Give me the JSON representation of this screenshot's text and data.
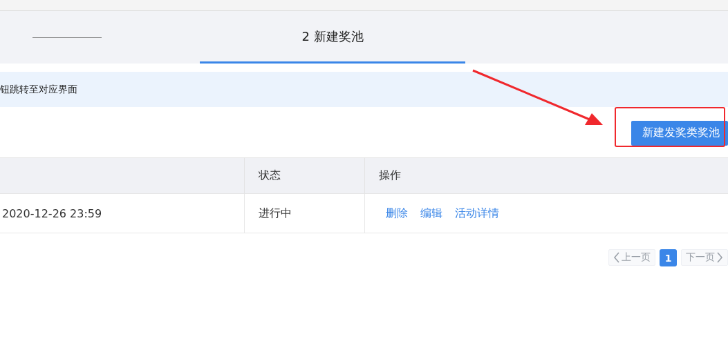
{
  "steps": [
    {
      "label": "2 新建奖池",
      "selected": true
    }
  ],
  "notice": {
    "text": "钮跳转至对应界面"
  },
  "create_button": {
    "label": "新建发奖类奖池"
  },
  "table": {
    "columns": [
      null,
      "状态",
      "操作"
    ],
    "rows": [
      {
        "cells": [
          "2020-12-26 23:59",
          "进行中"
        ],
        "actions": [
          "删除",
          "编辑",
          "活动详情"
        ]
      }
    ]
  },
  "pagination": {
    "prev": {
      "label": "上一页",
      "disabled": true
    },
    "pages": [
      {
        "label": "1",
        "selected": true
      }
    ],
    "next": {
      "label": "下一页",
      "disabled": true
    }
  }
}
